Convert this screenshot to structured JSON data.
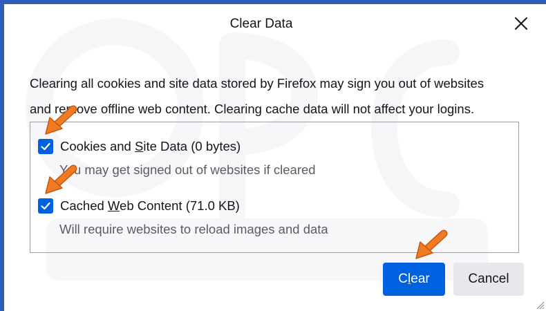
{
  "dialog": {
    "title": "Clear Data",
    "close_icon": "close-icon",
    "description_line1": "Clearing all cookies and site data stored by Firefox may sign you out of websites",
    "description_line2": "and remove offline web content. Clearing cache data will not affect your logins."
  },
  "options": [
    {
      "label_pre": "Cookies and ",
      "label_access": "S",
      "label_post": "ite Data (0 bytes)",
      "hint": "You may get signed out of websites if cleared",
      "checked": true
    },
    {
      "label_pre": "Cached ",
      "label_access": "W",
      "label_post": "eb Content (71.0 KB)",
      "hint": "Will require websites to reload images and data",
      "checked": true
    }
  ],
  "buttons": {
    "clear_pre": "C",
    "clear_access": "l",
    "clear_post": "ear",
    "cancel": "Cancel"
  },
  "colors": {
    "accent": "#0061e0",
    "frame": "#2e5fb8",
    "annotation_arrow": "#f07b22"
  }
}
